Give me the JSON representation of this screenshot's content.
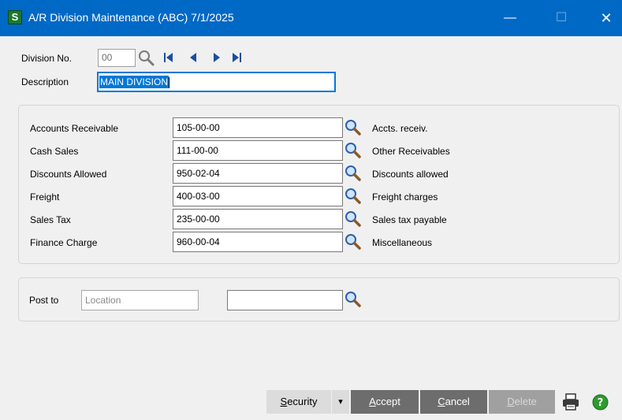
{
  "window": {
    "app_letter": "S",
    "title": "A/R Division Maintenance (ABC) 7/1/2025",
    "minimize": "—",
    "maximize": "☐",
    "close": "✕"
  },
  "header": {
    "division_label": "Division No.",
    "division_value": "00",
    "description_label": "Description",
    "description_value": "MAIN DIVISION"
  },
  "accounts": [
    {
      "label": "Accounts Receivable",
      "value": "105-00-00",
      "desc": "Accts. receiv."
    },
    {
      "label": "Cash Sales",
      "value": "111-00-00",
      "desc": "Other Receivables"
    },
    {
      "label": "Discounts Allowed",
      "value": "950-02-04",
      "desc": "Discounts allowed"
    },
    {
      "label": "Freight",
      "value": "400-03-00",
      "desc": "Freight charges"
    },
    {
      "label": "Sales Tax",
      "value": "235-00-00",
      "desc": "Sales tax payable"
    },
    {
      "label": "Finance Charge",
      "value": "960-00-04",
      "desc": "Miscellaneous"
    }
  ],
  "post_to": {
    "label": "Post to",
    "type_value": "Location",
    "location_value": ""
  },
  "buttons": {
    "security_first": "S",
    "security_rest": "ecurity",
    "dropdown": "▾",
    "accept_first": "A",
    "accept_rest": "ccept",
    "cancel_first": "C",
    "cancel_rest": "ancel",
    "delete_first": "D",
    "delete_rest": "elete"
  },
  "colors": {
    "titlebar": "#0069c6",
    "selection": "#0078d7",
    "button_dark": "#6d6d6d"
  }
}
